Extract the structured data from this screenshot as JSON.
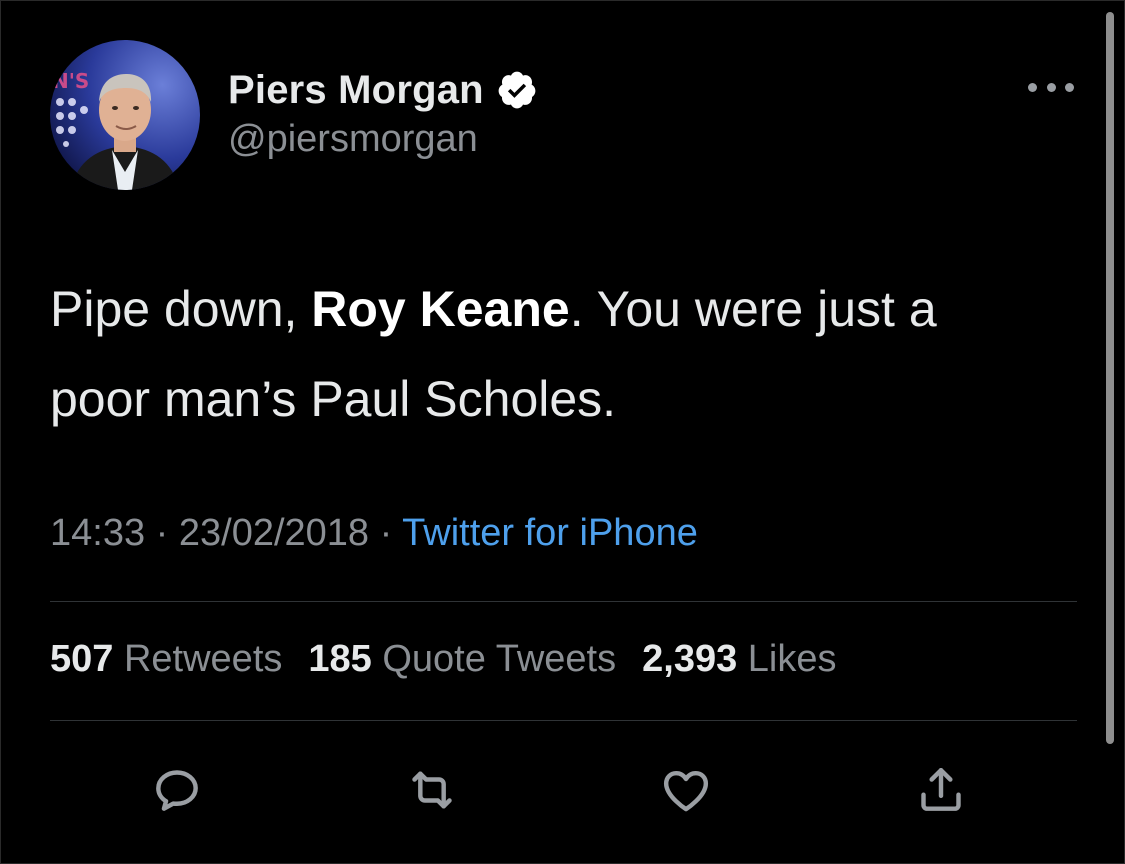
{
  "author": {
    "display_name": "Piers Morgan",
    "handle": "@piersmorgan",
    "verified": true,
    "avatar_icon": "profile-photo"
  },
  "tweet": {
    "text_parts": [
      "Pipe down, ",
      "Roy Keane",
      ". You were just a poor man’s Paul Scholes."
    ],
    "time": "14:33",
    "date": "23/02/2018",
    "separator": "·",
    "source": "Twitter for iPhone"
  },
  "stats": {
    "retweets_count": "507",
    "retweets_label": "Retweets",
    "quotes_count": "185",
    "quotes_label": "Quote Tweets",
    "likes_count": "2,393",
    "likes_label": "Likes"
  },
  "actions": [
    "reply-icon",
    "retweet-icon",
    "like-icon",
    "share-icon"
  ],
  "colors": {
    "background": "#000000",
    "link": "#4ea0ec",
    "verified": "#ffffff"
  }
}
